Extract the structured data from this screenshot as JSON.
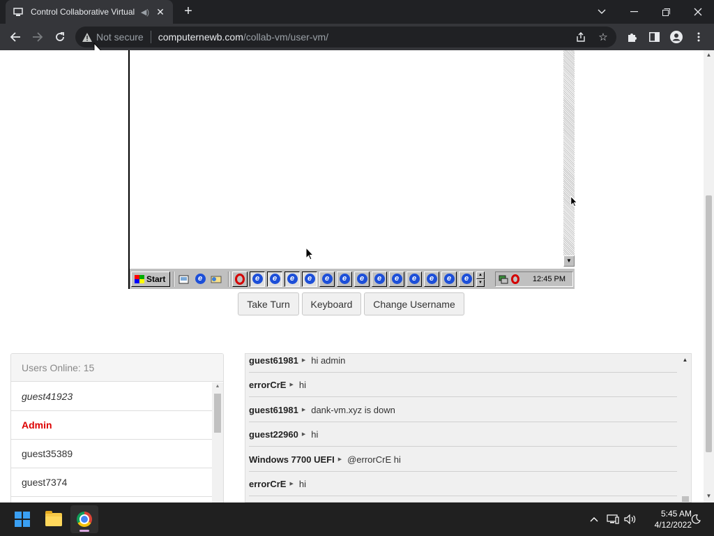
{
  "browser": {
    "tab_title": "Control Collaborative Virtual",
    "new_tab_icon": "plus-icon",
    "window_controls": [
      "chevron-down-icon",
      "minimize-icon",
      "restore-icon",
      "close-icon"
    ],
    "security_label": "Not secure",
    "url_host": "computernewb.com",
    "url_path": "/collab-vm/user-vm/"
  },
  "vm": {
    "start_label": "Start",
    "clock": "12:45 PM"
  },
  "buttons": {
    "take_turn": "Take Turn",
    "keyboard": "Keyboard",
    "change_username": "Change Username"
  },
  "users": {
    "header": "Users Online: 15",
    "items": [
      {
        "name": "guest41923",
        "style": "italic"
      },
      {
        "name": "Admin",
        "style": "admin"
      },
      {
        "name": "guest35389",
        "style": "normal"
      },
      {
        "name": "guest7374",
        "style": "normal"
      }
    ]
  },
  "chat": {
    "messages": [
      {
        "user": "guest61981",
        "text": "hi admin"
      },
      {
        "user": "errorCrE",
        "text": "hi"
      },
      {
        "user": "guest61981",
        "text": "dank-vm.xyz is down"
      },
      {
        "user": "guest22960",
        "text": "hi"
      },
      {
        "user": "Windows 7700 UEFI",
        "text": "@errorCrE hi"
      },
      {
        "user": "errorCrE",
        "text": "hi"
      }
    ]
  },
  "taskbar": {
    "time": "5:45 AM",
    "date": "4/12/2022"
  },
  "colors": {
    "admin": "#dd0000",
    "chrome_dark": "#202124",
    "chrome_toolbar": "#35363a"
  }
}
